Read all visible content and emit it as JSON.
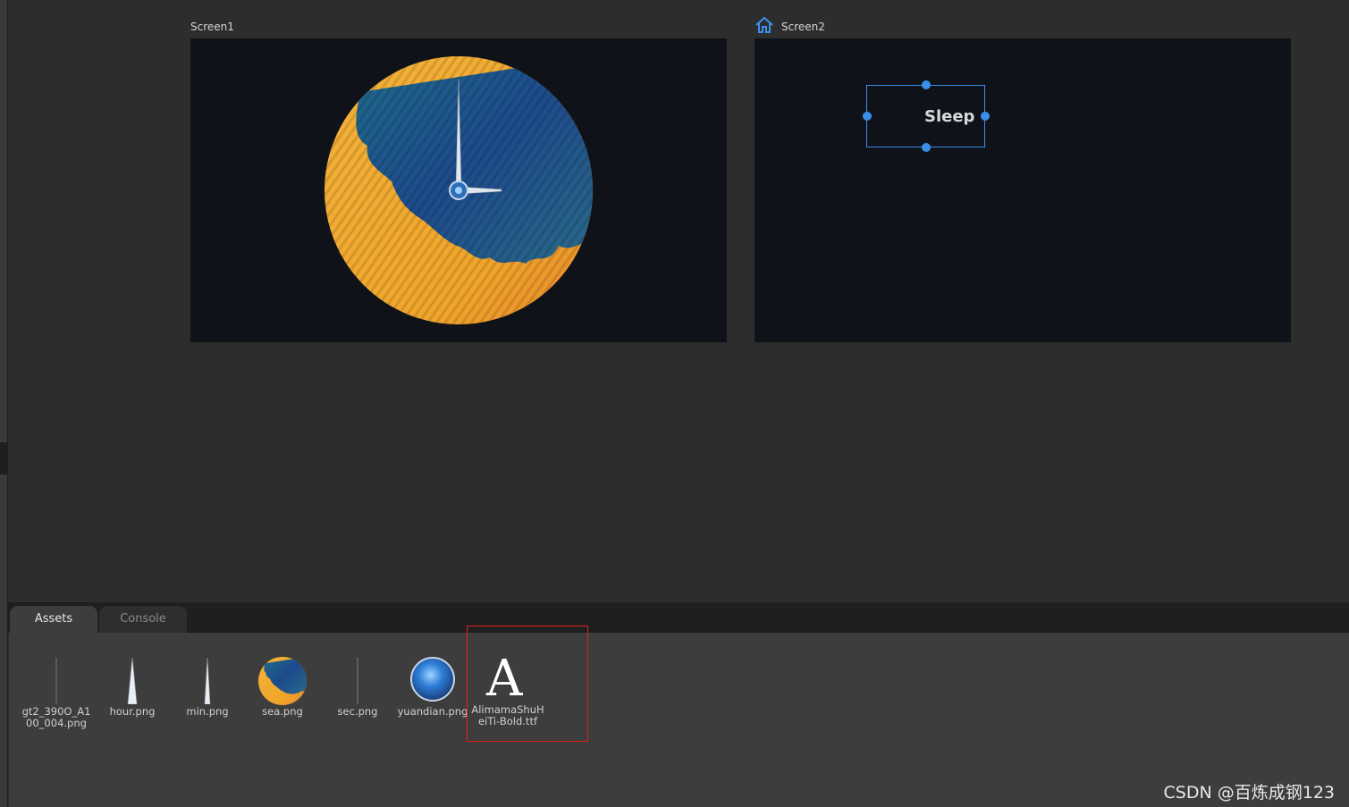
{
  "canvas": {
    "screens": [
      {
        "label": "Screen1",
        "is_home": false
      },
      {
        "label": "Screen2",
        "is_home": true
      }
    ],
    "screen2_widget": {
      "text": "Sleep",
      "selected": true
    },
    "icons": {
      "home": "home-icon",
      "hour_hand": "hour-hand",
      "minute_hand": "minute-hand",
      "center_cap": "clock-center-cap"
    }
  },
  "bottom_panel": {
    "tabs": [
      {
        "label": "Assets",
        "active": true
      },
      {
        "label": "Console",
        "active": false
      }
    ],
    "assets": [
      {
        "name": "gt2_390O_A100_004.png",
        "thumb": "thin-line"
      },
      {
        "name": "hour.png",
        "thumb": "hour-hand"
      },
      {
        "name": "min.png",
        "thumb": "minute-hand"
      },
      {
        "name": "sea.png",
        "thumb": "sea-circle"
      },
      {
        "name": "sec.png",
        "thumb": "thin-line"
      },
      {
        "name": "yuandian.png",
        "thumb": "blue-dot"
      },
      {
        "name": "AlimamaShuHeiTi-Bold.ttf",
        "thumb": "font-A",
        "highlighted": true
      }
    ]
  },
  "watermark": "CSDN @百炼成钢123",
  "colors": {
    "accent": "#3b8fe8",
    "highlight": "#e02020",
    "screen_bg": "#0f1218"
  }
}
